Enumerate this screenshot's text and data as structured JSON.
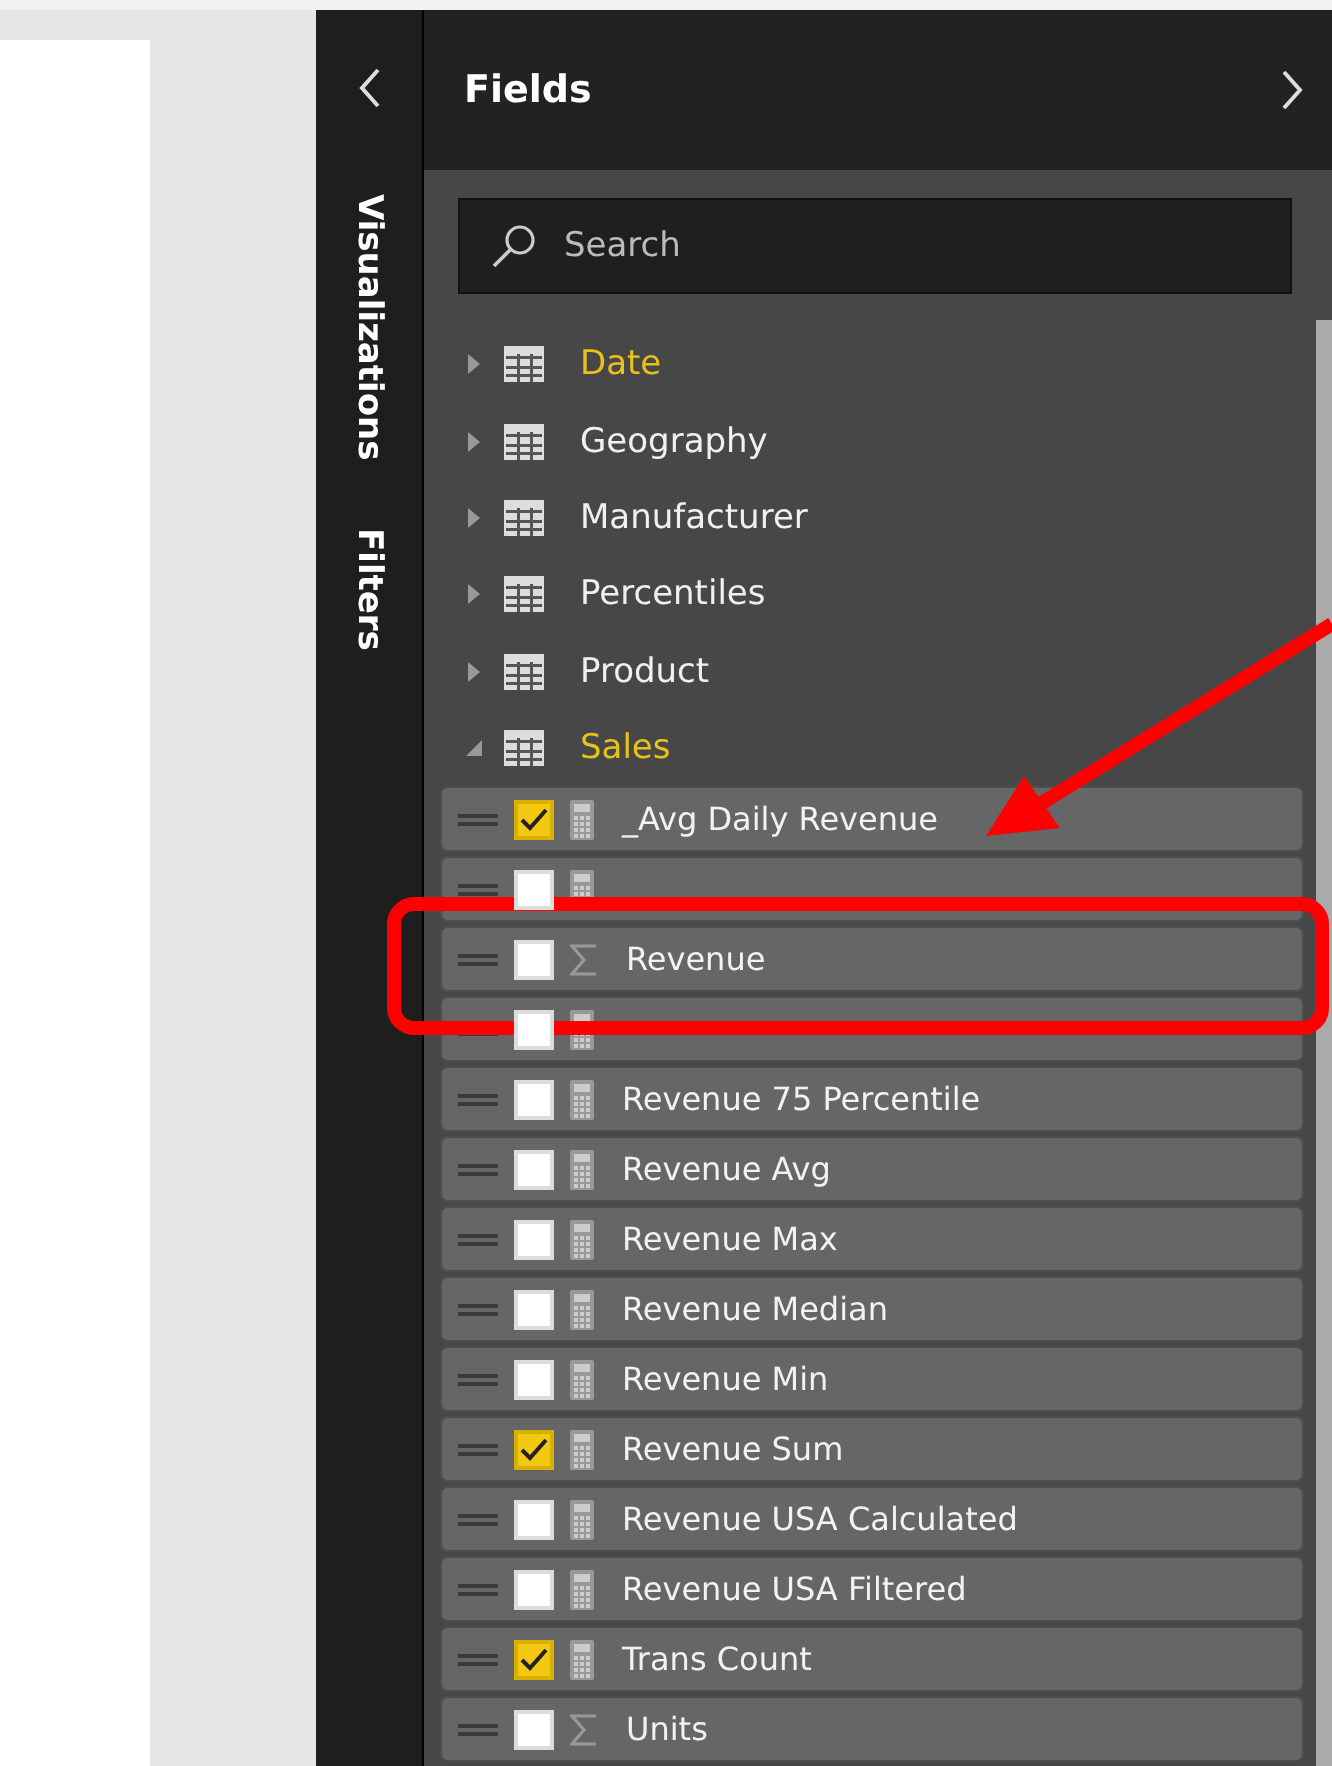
{
  "side_tabs": [
    {
      "label": "Visualizations"
    },
    {
      "label": "Filters"
    }
  ],
  "fields_pane": {
    "title": "Fields",
    "search": {
      "placeholder": "Search"
    },
    "tables": [
      {
        "name": "Date",
        "expanded": false,
        "in_use": true
      },
      {
        "name": "Geography",
        "expanded": false,
        "in_use": false
      },
      {
        "name": "Manufacturer",
        "expanded": false,
        "in_use": false
      },
      {
        "name": "Percentiles",
        "expanded": false,
        "in_use": false
      },
      {
        "name": "Product",
        "expanded": false,
        "in_use": false
      },
      {
        "name": "Sales",
        "expanded": true,
        "in_use": true,
        "children": [
          {
            "name": "_Avg Daily Revenue",
            "kind": "measure",
            "checked": true
          },
          {
            "kind": "measure",
            "checked": false
          },
          {
            "name": "Revenue",
            "kind": "sum",
            "checked": false
          },
          {
            "kind": "measure",
            "checked": false
          },
          {
            "name": "Revenue 75 Percentile",
            "kind": "measure",
            "checked": false
          },
          {
            "name": "Revenue Avg",
            "kind": "measure",
            "checked": false
          },
          {
            "name": "Revenue Max",
            "kind": "measure",
            "checked": false
          },
          {
            "name": "Revenue Median",
            "kind": "measure",
            "checked": false
          },
          {
            "name": "Revenue Min",
            "kind": "measure",
            "checked": false
          },
          {
            "name": "Revenue Sum",
            "kind": "measure",
            "checked": true
          },
          {
            "name": "Revenue USA Calculated",
            "kind": "measure",
            "checked": false
          },
          {
            "name": "Revenue USA Filtered",
            "kind": "measure",
            "checked": false
          },
          {
            "name": "Trans Count",
            "kind": "measure",
            "checked": true
          },
          {
            "name": "Units",
            "kind": "sum",
            "checked": false
          }
        ]
      }
    ]
  }
}
